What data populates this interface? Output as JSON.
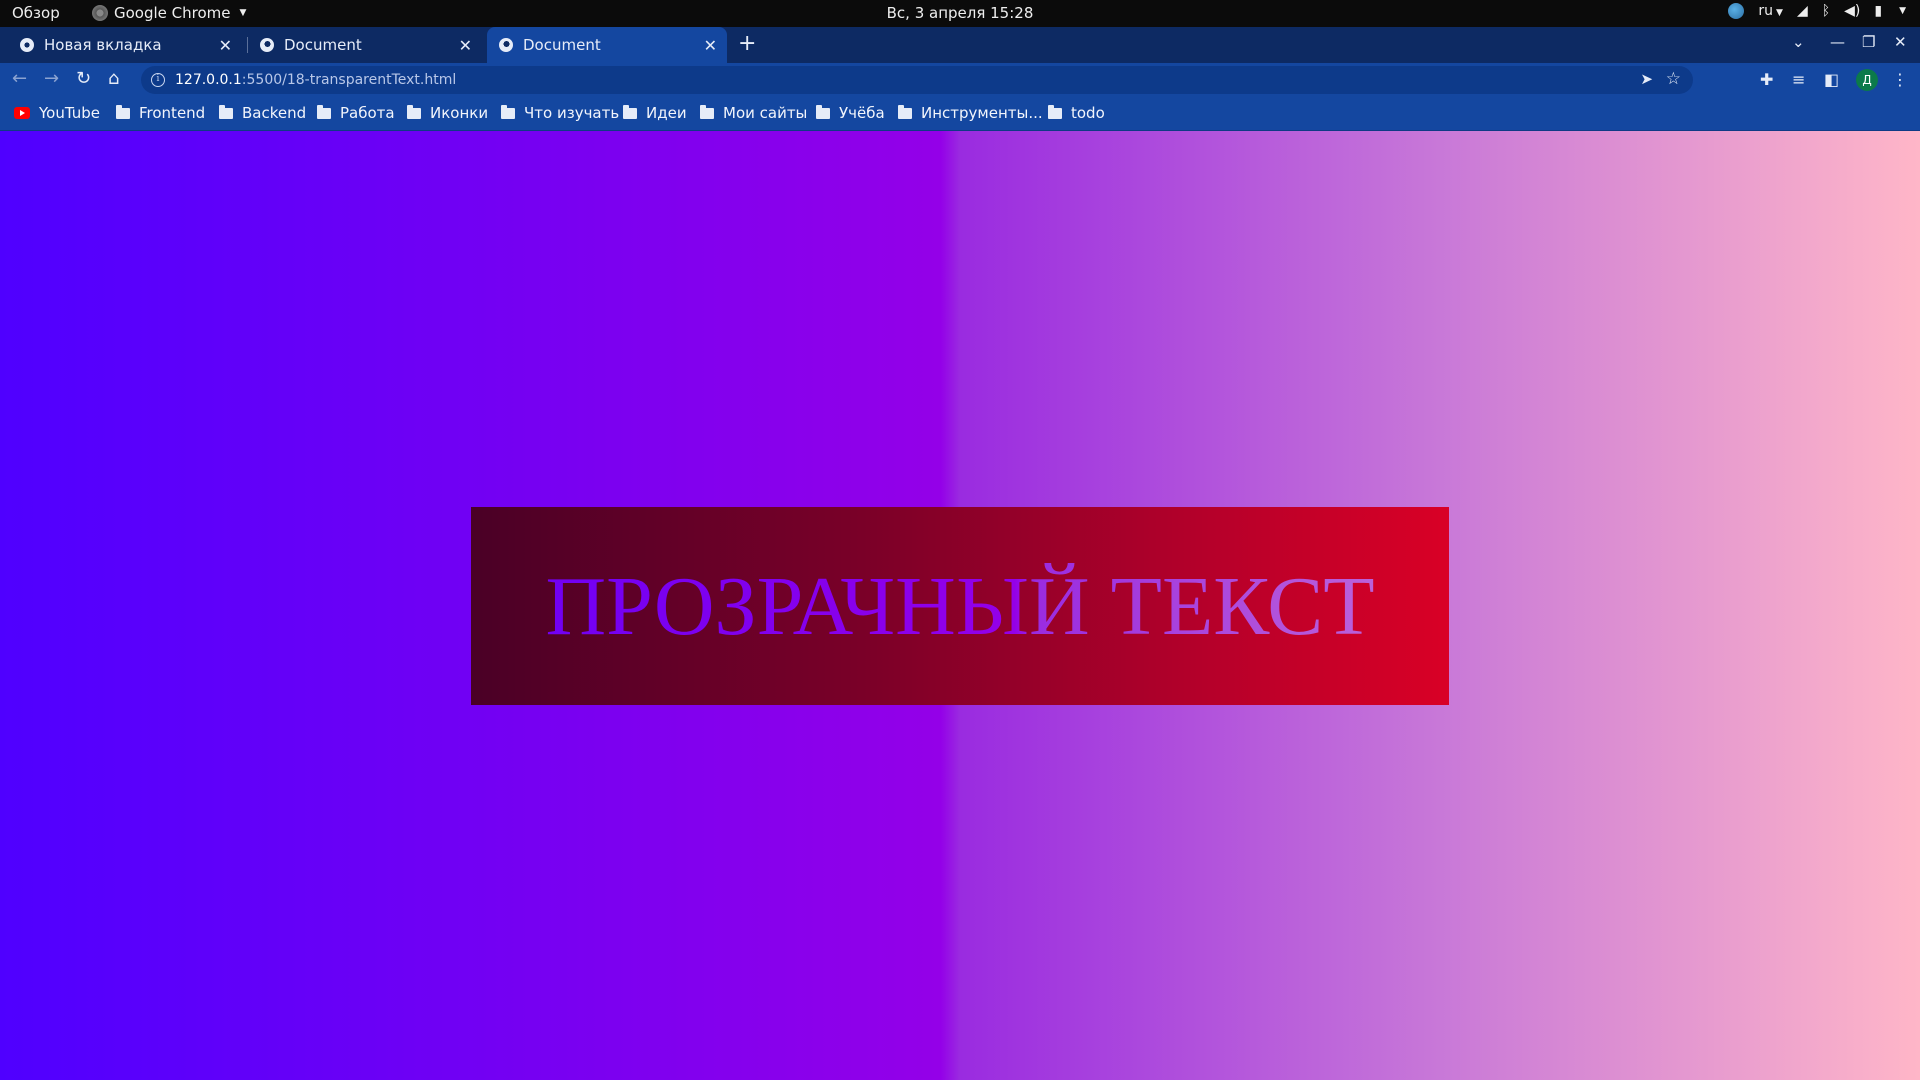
{
  "system_bar": {
    "activities": "Обзор",
    "app_name": "Google Chrome",
    "clock": "Вс, 3 апреля  15:28",
    "keyboard_layout": "ru"
  },
  "tabs": [
    {
      "title": "Новая вкладка",
      "icon": "chrome-icon",
      "active": false
    },
    {
      "title": "Document",
      "icon": "globe-icon",
      "active": false
    },
    {
      "title": "Document",
      "icon": "globe-icon",
      "active": true
    }
  ],
  "address_bar": {
    "host": "127.0.0.1",
    "path": ":5500/18-transparentText.html"
  },
  "profile": {
    "initial": "Д"
  },
  "bookmarks": [
    {
      "label": "YouTube",
      "icon": "youtube-icon"
    },
    {
      "label": "Frontend",
      "icon": "folder-icon"
    },
    {
      "label": "Backend",
      "icon": "folder-icon"
    },
    {
      "label": "Работа",
      "icon": "folder-icon"
    },
    {
      "label": "Иконки",
      "icon": "folder-icon"
    },
    {
      "label": "Что изучать",
      "icon": "folder-icon"
    },
    {
      "label": "Идеи",
      "icon": "folder-icon"
    },
    {
      "label": "Мои сайты",
      "icon": "folder-icon"
    },
    {
      "label": "Учёба",
      "icon": "folder-icon"
    },
    {
      "label": "Инструменты...",
      "icon": "folder-icon"
    },
    {
      "label": "todo",
      "icon": "folder-icon"
    }
  ],
  "page": {
    "heading": "ПРОЗРАЧНЫЙ ТЕКСТ",
    "colors": {
      "bg_start": "#4f00ff",
      "bg_mid": "#9400e8",
      "bg_end": "#ffb6c8",
      "box_start": "#4a0026",
      "box_end": "#d90026"
    }
  }
}
